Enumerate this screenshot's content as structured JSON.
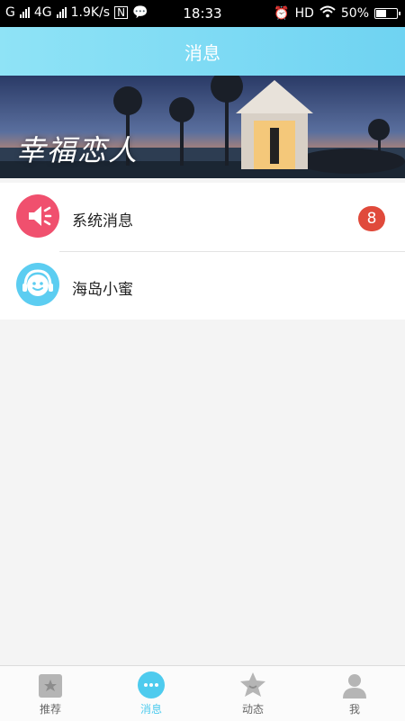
{
  "status_bar": {
    "carrier1": "G",
    "carrier2": "4G",
    "speed": "1.9K/s",
    "time": "18:33",
    "hd": "HD",
    "battery": "50%",
    "battery_level": 0.5
  },
  "header": {
    "title": "消息"
  },
  "banner": {
    "text": "幸福恋人"
  },
  "messages": [
    {
      "label": "系统消息",
      "badge": "8",
      "icon": "speaker-icon",
      "color": "#f0506e"
    },
    {
      "label": "海岛小蜜",
      "badge": "",
      "icon": "smiley-headset-icon",
      "color": "#5ccdf1"
    }
  ],
  "tabs": [
    {
      "label": "推荐",
      "icon": "star-card-icon",
      "active": false
    },
    {
      "label": "消息",
      "icon": "chat-bubble-icon",
      "active": true
    },
    {
      "label": "动态",
      "icon": "star-icon",
      "active": false
    },
    {
      "label": "我",
      "icon": "person-icon",
      "active": false
    }
  ],
  "colors": {
    "accent": "#6fd3f2",
    "badge": "#e04a3b",
    "active_tab": "#4ecbee"
  }
}
